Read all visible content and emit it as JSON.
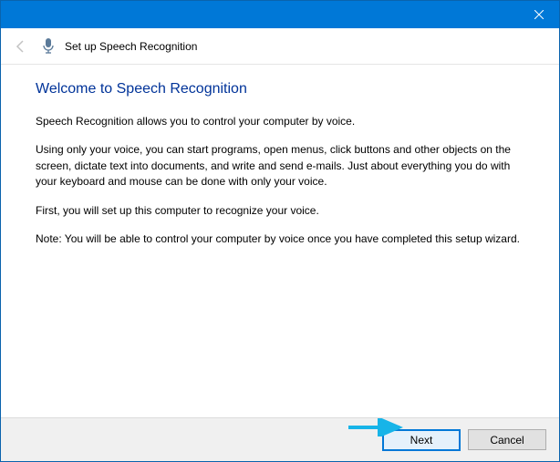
{
  "titlebar": {
    "close_icon": "close"
  },
  "header": {
    "title": "Set up Speech Recognition"
  },
  "content": {
    "heading": "Welcome to Speech Recognition",
    "p1": "Speech Recognition allows you to control your computer by voice.",
    "p2": "Using only your voice, you can start programs, open menus, click buttons and other objects on the screen, dictate text into documents, and write and send e-mails. Just about everything you do with your keyboard and mouse can be done with only your voice.",
    "p3": "First, you will set up this computer to recognize your voice.",
    "p4": "Note: You will be able to control your computer by voice once you have completed this setup wizard."
  },
  "footer": {
    "next_label": "Next",
    "cancel_label": "Cancel"
  }
}
